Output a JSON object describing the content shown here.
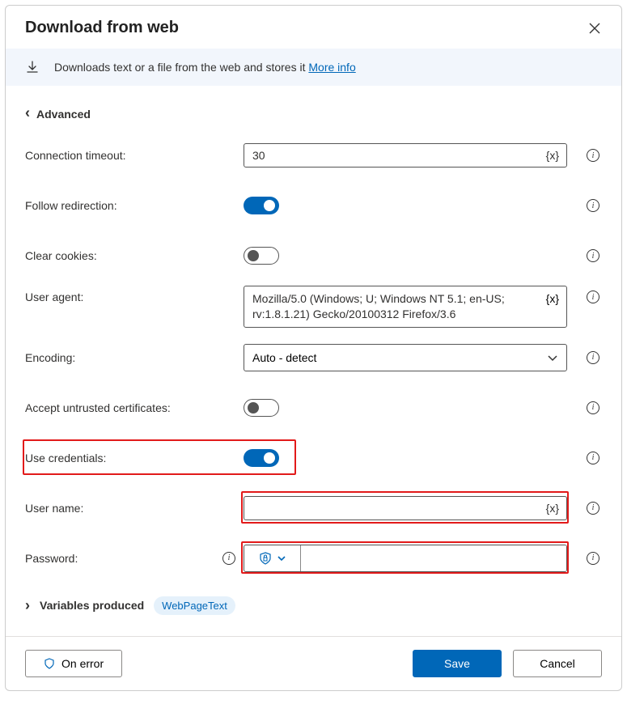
{
  "title": "Download from web",
  "banner": {
    "text": "Downloads text or a file from the web and stores it ",
    "link": "More info"
  },
  "section": "Advanced",
  "fields": {
    "connection_timeout": {
      "label": "Connection timeout:",
      "value": "30",
      "token": "{x}"
    },
    "follow_redirection": {
      "label": "Follow redirection:",
      "on": true
    },
    "clear_cookies": {
      "label": "Clear cookies:",
      "on": false
    },
    "user_agent": {
      "label": "User agent:",
      "value": "Mozilla/5.0 (Windows; U; Windows NT 5.1; en-US; rv:1.8.1.21) Gecko/20100312 Firefox/3.6",
      "token": "{x}"
    },
    "encoding": {
      "label": "Encoding:",
      "value": "Auto - detect"
    },
    "accept_untrusted": {
      "label": "Accept untrusted certificates:",
      "on": false
    },
    "use_credentials": {
      "label": "Use credentials:",
      "on": true
    },
    "user_name": {
      "label": "User name:",
      "value": "",
      "token": "{x}"
    },
    "password": {
      "label": "Password:",
      "value": ""
    }
  },
  "vars": {
    "label": "Variables produced",
    "chip": "WebPageText"
  },
  "buttons": {
    "on_error": "On error",
    "save": "Save",
    "cancel": "Cancel"
  }
}
